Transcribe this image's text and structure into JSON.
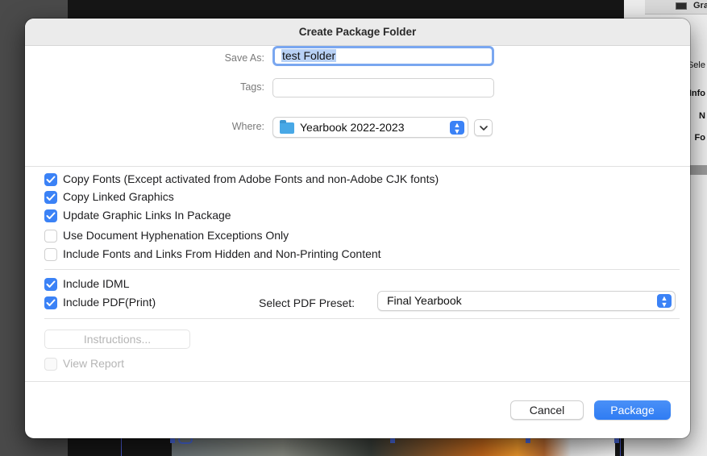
{
  "background_app": {
    "right_panel": {
      "title": "Gradi",
      "labels": [
        "Sele",
        "Info",
        "N",
        "Fo"
      ]
    }
  },
  "dialog": {
    "title": "Create Package Folder",
    "save_as": {
      "label": "Save As:",
      "value": "test Folder"
    },
    "tags": {
      "label": "Tags:",
      "value": ""
    },
    "where": {
      "label": "Where:",
      "value": "Yearbook 2022-2023",
      "icon": "folder-icon"
    },
    "options": [
      {
        "label": "Copy Fonts (Except activated from Adobe Fonts and non-Adobe CJK fonts)",
        "checked": true,
        "enabled": true
      },
      {
        "label": "Copy Linked Graphics",
        "checked": true,
        "enabled": true
      },
      {
        "label": "Update Graphic Links In Package",
        "checked": true,
        "enabled": true
      },
      {
        "label": "Use Document Hyphenation Exceptions Only",
        "checked": false,
        "enabled": true
      },
      {
        "label": "Include Fonts and Links From Hidden and Non-Printing Content",
        "checked": false,
        "enabled": true
      }
    ],
    "include_idml": {
      "label": "Include IDML",
      "checked": true
    },
    "include_pdf": {
      "label": "Include PDF(Print)",
      "checked": true
    },
    "pdf_preset": {
      "label": "Select PDF Preset:",
      "value": "Final Yearbook"
    },
    "instructions_button": {
      "label": "Instructions...",
      "enabled": false
    },
    "view_report": {
      "label": "View Report",
      "checked": false,
      "enabled": false
    },
    "buttons": {
      "cancel": "Cancel",
      "package": "Package"
    }
  },
  "colors": {
    "accent": "#3b82f6",
    "focus_ring": "#7aa7f0",
    "selection": "#b8d1f5"
  }
}
